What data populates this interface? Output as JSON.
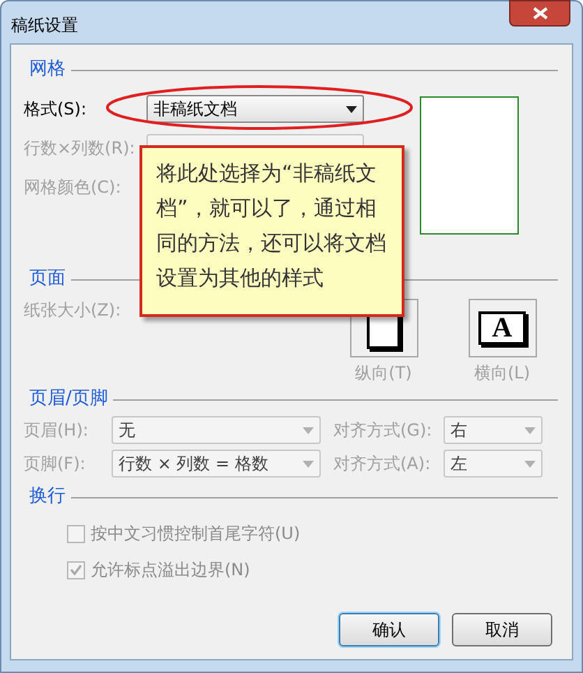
{
  "window": {
    "title": "稿纸设置"
  },
  "grid": {
    "title": "网格",
    "fields": [
      {
        "label": "格式(S):",
        "value": "非稿纸文档",
        "disabled": false
      },
      {
        "label": "行数×列数(R):",
        "disabled": true
      },
      {
        "label": "网格颜色(C):",
        "disabled": true
      }
    ]
  },
  "page": {
    "title": "页面",
    "paper_size": {
      "label": "纸张大小(Z):",
      "disabled": true
    },
    "orientation": [
      {
        "label": "纵向(T)",
        "disabled": true
      },
      {
        "label": "横向(L)",
        "glyph": "A",
        "disabled": true
      }
    ]
  },
  "header_footer": {
    "title": "页眉/页脚",
    "rows": [
      {
        "label": "页眉(H):",
        "value": "无",
        "align_label": "对齐方式(G):",
        "align_value": "右",
        "disabled": true
      },
      {
        "label": "页脚(F):",
        "value": "行数 × 列数 = 格数",
        "align_label": "对齐方式(A):",
        "align_value": "左",
        "disabled": true
      }
    ]
  },
  "line_wrap": {
    "title": "换行",
    "options": [
      {
        "label": "按中文习惯控制首尾字符(U)",
        "checked": false,
        "disabled": true
      },
      {
        "label": "允许标点溢出边界(N)",
        "checked": true,
        "disabled": true
      }
    ]
  },
  "buttons": [
    {
      "label": "确认",
      "default": true
    },
    {
      "label": "取消",
      "default": false
    }
  ],
  "callout": {
    "text": "将此处选择为“非稿纸文档”，就可以了，通过相同的方法，还可以将文档设置为其他的样式"
  }
}
